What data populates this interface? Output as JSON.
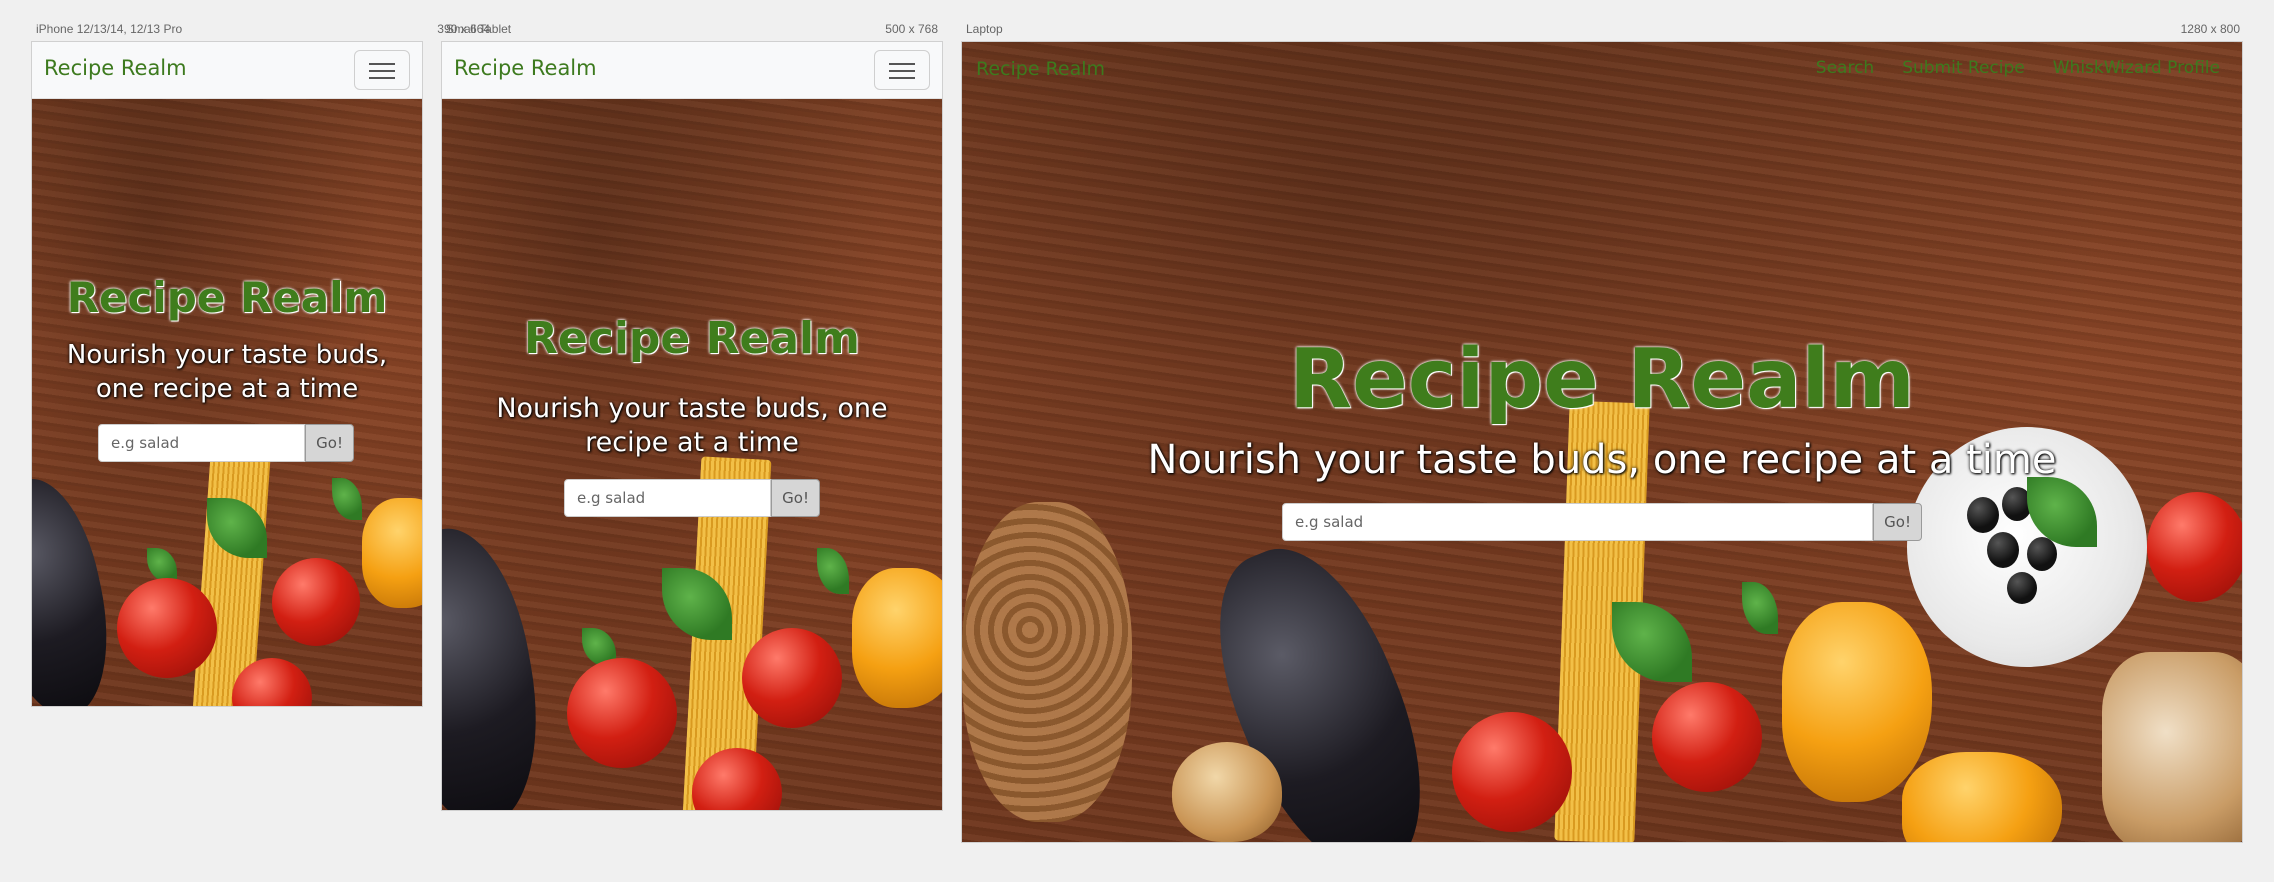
{
  "frames": [
    {
      "label": "iPhone 12/13/14, 12/13 Pro",
      "size": "390 x 664",
      "brand": "Recipe Realm",
      "hero_title": "Recipe Realm",
      "hero_subtitle": "Nourish your taste buds, one recipe at a time",
      "search_placeholder": "e.g salad",
      "search_button": "Go!"
    },
    {
      "label": "Small Tablet",
      "size": "500 x 768",
      "brand": "Recipe Realm",
      "hero_title": "Recipe Realm",
      "hero_subtitle": "Nourish your taste buds, one recipe at a time",
      "search_placeholder": "e.g salad",
      "search_button": "Go!"
    },
    {
      "label": "Laptop",
      "size": "1280 x 800",
      "brand": "Recipe Realm",
      "nav_links": [
        "Search",
        "Submit Recipe",
        "WhiskWizard Profile"
      ],
      "hero_title": "Recipe Realm",
      "hero_subtitle": "Nourish your taste buds, one recipe at a time",
      "search_placeholder": "e.g salad",
      "search_button": "Go!"
    }
  ],
  "colors": {
    "brand_green": "#3d7a1e",
    "navbar_bg": "#f8f9fa",
    "page_bg": "#f0f0f0",
    "button_bg": "#d6d6d6"
  },
  "icons": {
    "menu_toggle": "hamburger-menu-icon"
  }
}
